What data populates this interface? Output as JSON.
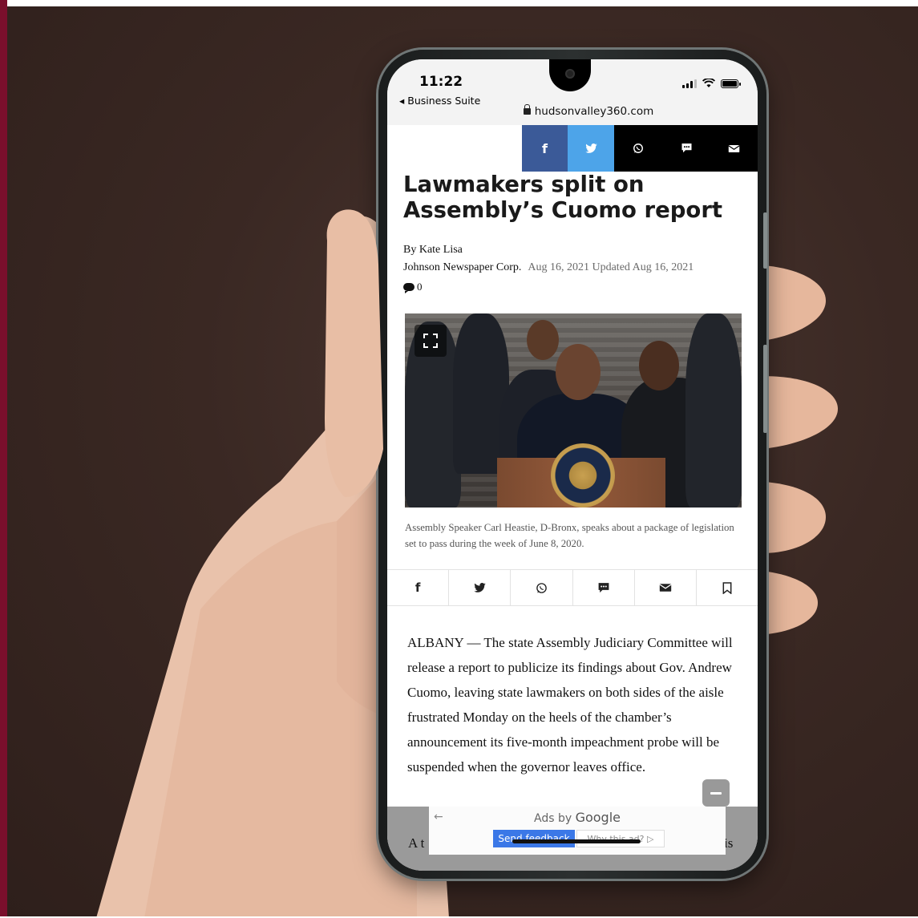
{
  "status_bar": {
    "time": "11:22",
    "back_app": "◂ Business Suite",
    "url": "hudsonvalley360.com"
  },
  "share_top": {
    "facebook_icon": "f",
    "twitter_icon": "twitter-bird",
    "whatsapp_icon": "whatsapp",
    "sms_icon": "sms-bubble",
    "email_icon": "envelope"
  },
  "article": {
    "headline": "Lawmakers split on Assembly’s Cuomo report",
    "byline": "By Kate Lisa",
    "publisher": "Johnson Newspaper Corp.",
    "dates": "Aug 16, 2021 Updated Aug 16, 2021",
    "comment_count": "0",
    "caption": "Assembly Speaker Carl Heastie, D-Bronx, speaks about a package of legislation set to pass during the week of June 8, 2020.",
    "body": "ALBANY — The state Assembly Judiciary Committee will release a report to publicize its findings about Gov. Andrew Cuomo, leaving state lawmakers on both sides of the aisle frustrated Monday on the heels of the chamber’s announcement its five-month impeachment probe will be suspended when the governor leaves office."
  },
  "share_row": {
    "facebook": "f",
    "twitter": "twitter-bird",
    "whatsapp": "whatsapp",
    "sms": "sms-bubble",
    "email": "envelope",
    "bookmark": "bookmark"
  },
  "ad": {
    "back_arrow": "←",
    "ads_by": "Ads by ",
    "google": "Google",
    "send_feedback": "Send feedback",
    "why_ad": "Why this ad? ▷",
    "edge_left": "A t",
    "edge_right": "is"
  },
  "colors": {
    "facebook": "#3b5a98",
    "twitter": "#4da4e9",
    "background": "#3a2823",
    "crimson": "#7a0f2c"
  }
}
